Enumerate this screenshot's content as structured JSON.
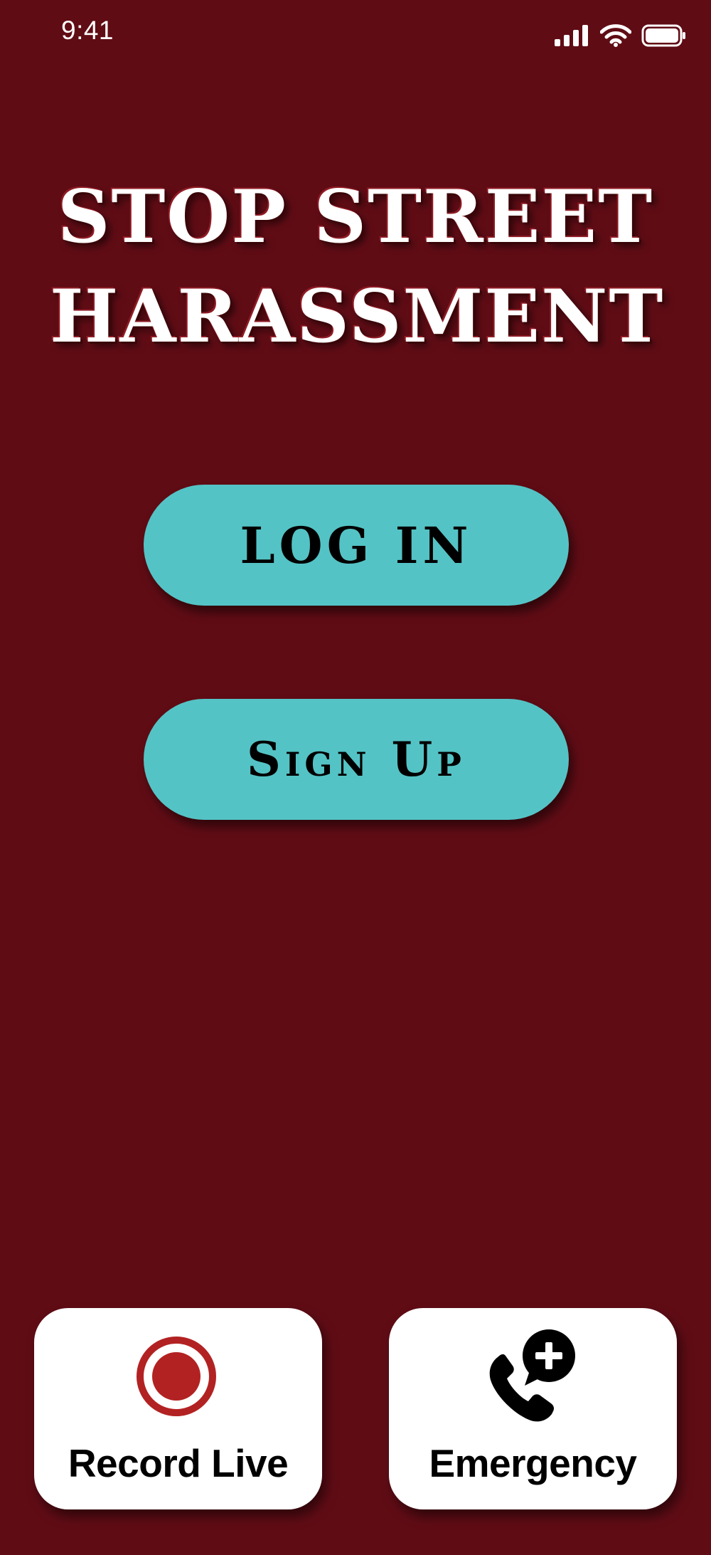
{
  "status_bar": {
    "time": "9:41"
  },
  "title": {
    "line1": "STOP STREET",
    "line2": "HARASSMENT"
  },
  "auth": {
    "login_label": "LOG IN",
    "signup_label": "Sign Up"
  },
  "actions": {
    "record_label": "Record Live",
    "emergency_label": "Emergency"
  },
  "icons": {
    "signal": "cellular-signal-icon",
    "wifi": "wifi-icon",
    "battery": "battery-icon",
    "record": "record-icon",
    "emergency": "phone-plus-icon"
  },
  "colors": {
    "background": "#600c15",
    "button": "#54c3c5",
    "card": "#ffffff",
    "record_red": "#b22222"
  }
}
